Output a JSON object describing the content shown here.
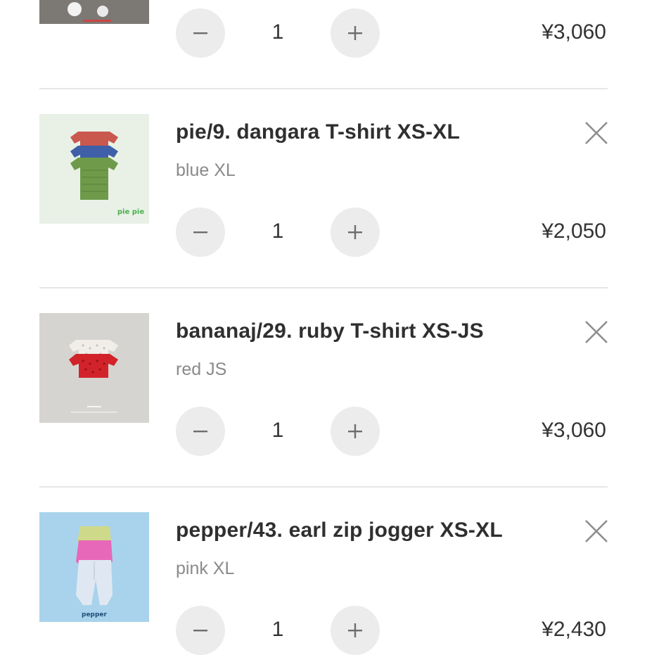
{
  "cart": {
    "top_item": {
      "quantity": "1",
      "price": "¥3,060",
      "minus_icon": "minus-icon",
      "plus_icon": "plus-icon"
    },
    "items": [
      {
        "title": "pie/9. dangara T-shirt XS-XL",
        "variant": "blue XL",
        "quantity": "1",
        "price": "¥2,050",
        "brand_mark": "pie pie",
        "thumb_bg": "#e9f1e6"
      },
      {
        "title": "bananaj/29. ruby T-shirt XS-JS",
        "variant": "red JS",
        "quantity": "1",
        "price": "¥3,060",
        "brand_mark": "",
        "thumb_bg": "#d6d4d1"
      },
      {
        "title": "pepper/43. earl zip jogger XS-XL",
        "variant": "pink XL",
        "quantity": "1",
        "price": "¥2,430",
        "brand_mark": "pepper",
        "thumb_bg": "#a9d3ec"
      }
    ],
    "icons": {
      "remove": "close-icon",
      "decrease": "minus-icon",
      "increase": "plus-icon"
    }
  }
}
